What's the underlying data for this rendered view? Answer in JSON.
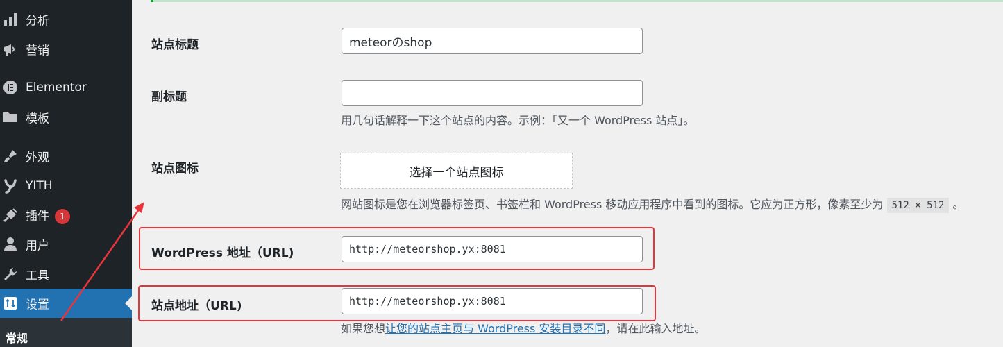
{
  "sidebar": {
    "items": [
      {
        "label": "分析",
        "icon": "bar-chart-icon"
      },
      {
        "label": "营销",
        "icon": "megaphone-icon"
      },
      {
        "label": "Elementor",
        "icon": "elementor-icon"
      },
      {
        "label": "模板",
        "icon": "folder-icon"
      },
      {
        "label": "外观",
        "icon": "paintbrush-icon"
      },
      {
        "label": "YITH",
        "icon": "yith-icon"
      },
      {
        "label": "插件",
        "icon": "plugin-icon",
        "badge": "1"
      },
      {
        "label": "用户",
        "icon": "user-icon"
      },
      {
        "label": "工具",
        "icon": "wrench-icon"
      },
      {
        "label": "设置",
        "icon": "settings-icon",
        "active": true
      }
    ],
    "submenu_current": "常规",
    "colors": {
      "background": "#1d2327",
      "active": "#2271b1",
      "badge": "#d63638"
    }
  },
  "form": {
    "site_title": {
      "label": "站点标题",
      "value": "meteorのshop"
    },
    "tagline": {
      "label": "副标题",
      "value": "",
      "description": "用几句话解释一下这个站点的内容。示例：「又一个 WordPress 站点」。"
    },
    "site_icon": {
      "label": "站点图标",
      "button_label": "选择一个站点图标",
      "description_prefix": "网站图标是您在浏览器标签页、书签栏和 WordPress 移动应用程序中看到的图标。它应为正方形，像素至少为",
      "description_size": "512 × 512",
      "description_suffix": "。"
    },
    "wordpress_url": {
      "label": "WordPress 地址（URL)",
      "value": "http://meteorshop.yx:8081"
    },
    "site_url": {
      "label": "站点地址（URL)",
      "value": "http://meteorshop.yx:8081",
      "description_prefix": "如果您想",
      "description_link": "让您的站点主页与 WordPress 安装目录不同",
      "description_suffix": "，请在此输入地址。"
    }
  },
  "annotation": {
    "color": "#e8353c"
  }
}
